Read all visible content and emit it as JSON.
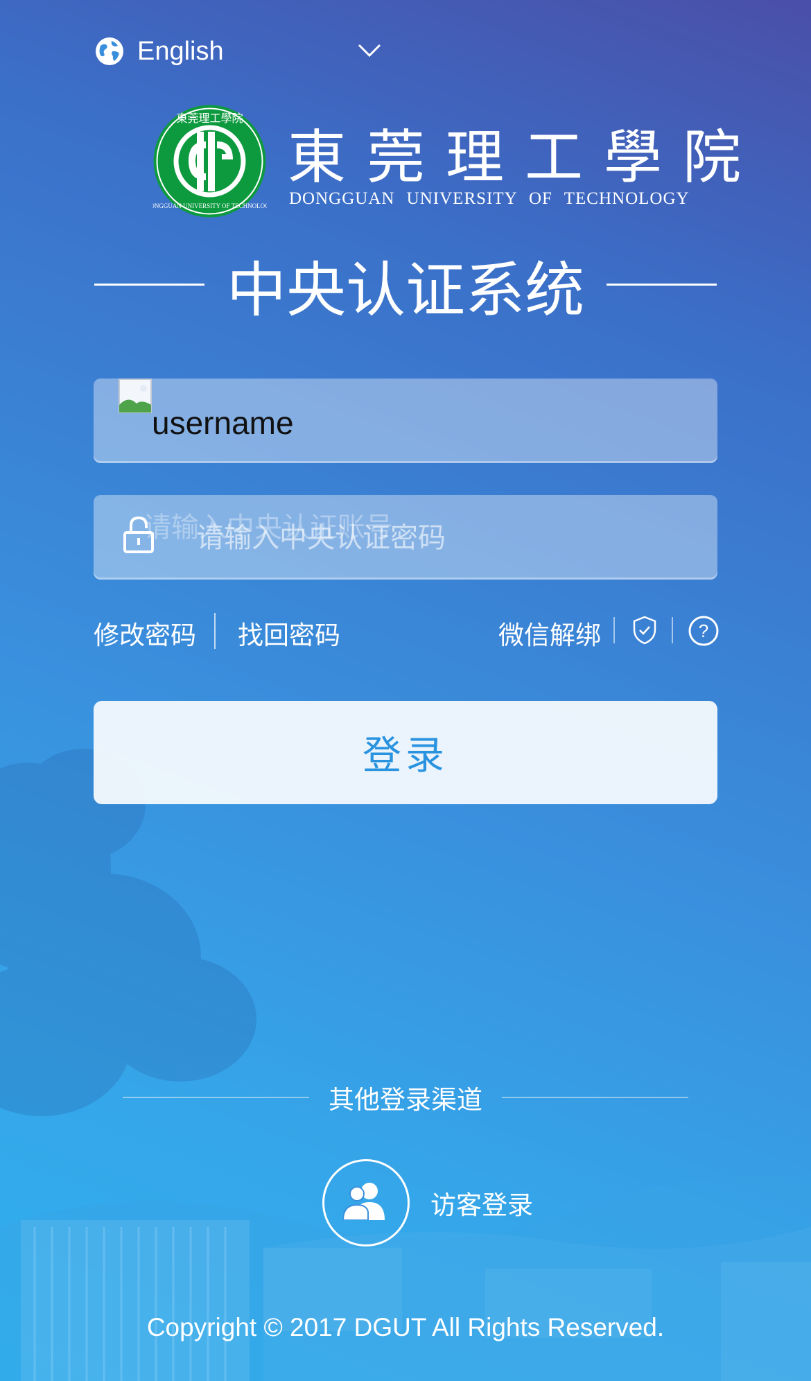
{
  "language": {
    "label": "English",
    "globe_icon": "globe-icon",
    "chevron_icon": "chevron-down-icon"
  },
  "logo": {
    "school_name_cn": "東莞理工學院",
    "school_name_en": "DONGGUAN UNIVERSITY OF TECHNOLOGY",
    "seal_text": "東莞理工學院",
    "seal_ring_text": "DONGGUAN UNIVERSITY OF TECHNOLOGY"
  },
  "system_title": "中央认证系统",
  "username": {
    "value": "username",
    "placeholder_ghost": "请输入中央认证账号"
  },
  "password": {
    "placeholder": "请输入中央认证密码",
    "icon": "lock-icon"
  },
  "links": {
    "change_password": "修改密码",
    "recover_password": "找回密码",
    "wechat_unbind": "微信解绑",
    "shield_icon": "shield-check-icon",
    "help_icon": "help-circle-icon"
  },
  "login_button": "登录",
  "other_login": {
    "title": "其他登录渠道",
    "guest_label": "访客登录",
    "guest_icon": "users-icon"
  },
  "copyright": "Copyright © 2017 DGUT All Rights Reserved.",
  "colors": {
    "accent": "#2a93e0",
    "seal_green": "#0d9a3e",
    "bg_top": "#4a4fa8",
    "bg_bottom": "#2fb0ee"
  }
}
